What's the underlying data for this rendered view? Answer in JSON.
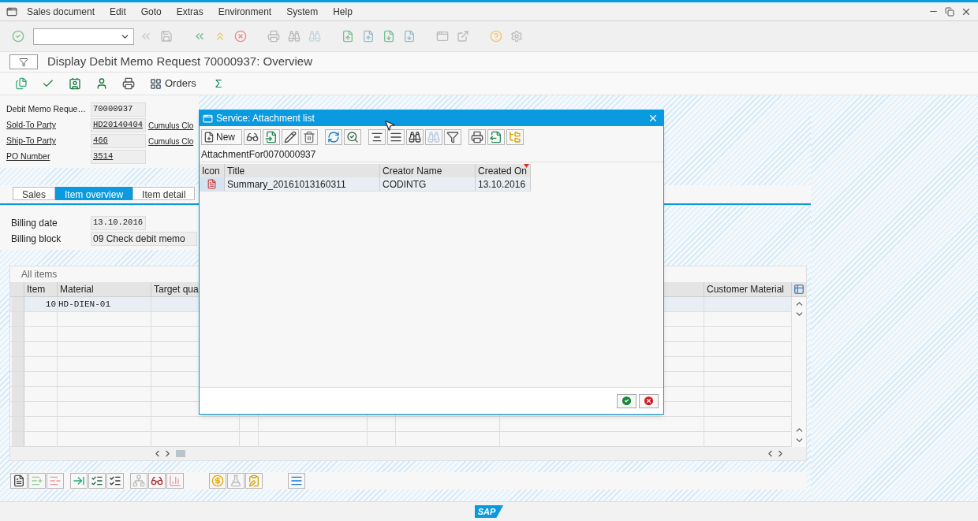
{
  "menu": [
    "Sales document",
    "Edit",
    "Goto",
    "Extras",
    "Environment",
    "System",
    "Help"
  ],
  "title": "Display Debit Memo Request 70000937: Overview",
  "app_toolbar": {
    "orders": "Orders",
    "sum": "Σ"
  },
  "header_fields": [
    {
      "label": "Debit Memo Reque…",
      "value": "70000937",
      "link": false
    },
    {
      "label": "Sold-To Party",
      "value": "HD20140404",
      "link": true,
      "description": "Cumulus Clo"
    },
    {
      "label": "Ship-To Party",
      "value": "466",
      "link": true,
      "description": "Cumulus Clo"
    },
    {
      "label": "PO Number",
      "value": "3514",
      "link": true
    }
  ],
  "tabs": [
    {
      "label": "Sales",
      "selected": false
    },
    {
      "label": "Item overview",
      "selected": true
    },
    {
      "label": "Item detail",
      "selected": false
    }
  ],
  "billing_fields": [
    {
      "label": "Billing date",
      "value": "13.10.2016"
    },
    {
      "label": "Billing block",
      "value": "09 Check debit memo"
    }
  ],
  "items_table": {
    "title": "All items",
    "columns": [
      "Item",
      "Material",
      "Target qua",
      "Customer Material"
    ],
    "rows": [
      {
        "item": "10",
        "material": "HD-DIEN-01"
      }
    ]
  },
  "dialog": {
    "title": "Service: Attachment list",
    "new_button": "New",
    "caption": "AttachmentFor0070000937",
    "columns": [
      "Icon",
      "Title",
      "Creator Name",
      "Created On"
    ],
    "rows": [
      {
        "title": "Summary_20161013160311",
        "creator": "CODINTG",
        "created_on": "13.10.2016"
      }
    ]
  },
  "status_bar": {
    "logo": "SAP"
  }
}
